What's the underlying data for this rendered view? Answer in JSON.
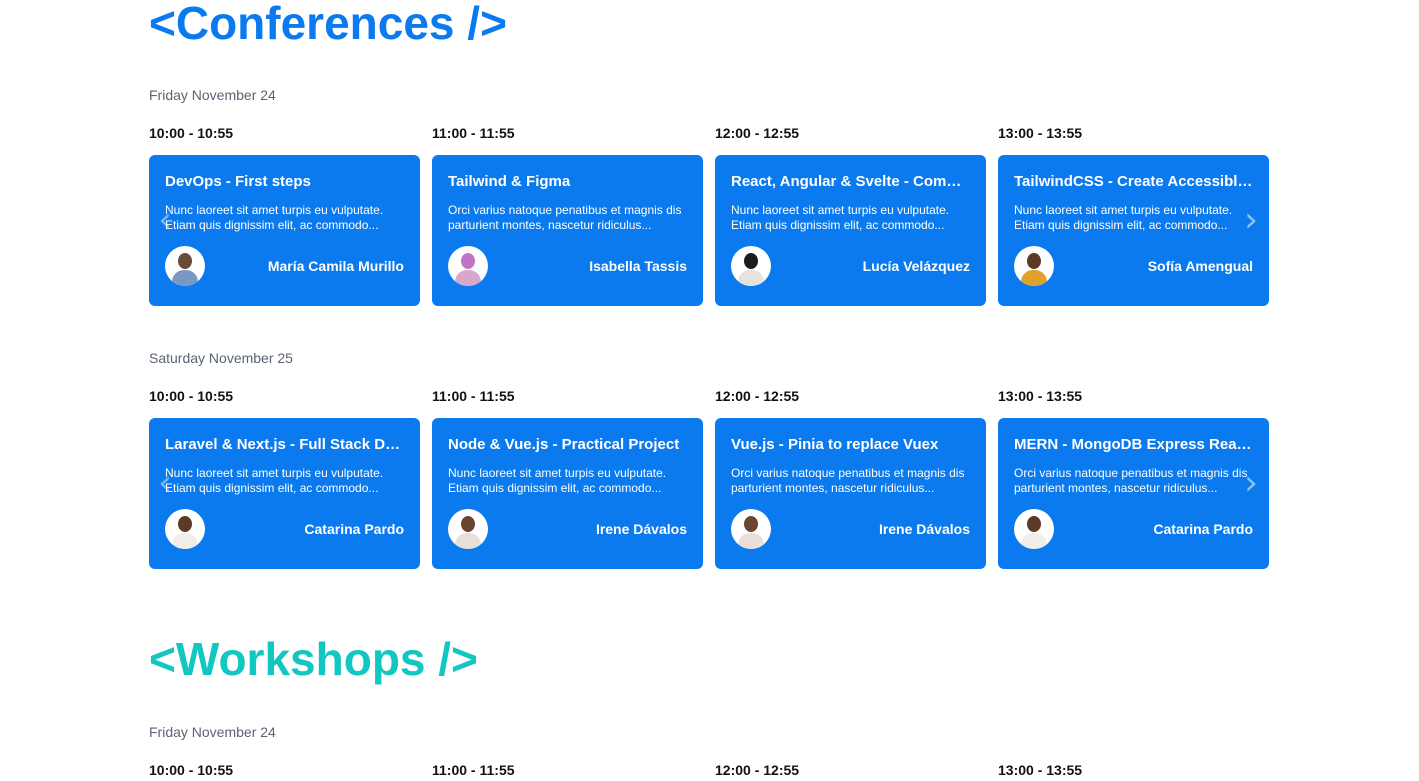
{
  "conferences": {
    "title": "<Conferences />",
    "days": [
      {
        "label": "Friday November 24",
        "times": [
          "10:00 - 10:55",
          "11:00 - 11:55",
          "12:00 - 12:55",
          "13:00 - 13:55"
        ],
        "cards": [
          {
            "title": "DevOps - First steps",
            "desc": "Nunc laoreet sit amet turpis eu vulputate. Etiam quis dignissim elit, ac commodo...",
            "speaker": "María Camila Murillo",
            "avatar_colors": [
              "#6b4a3a",
              "#7a98c6"
            ]
          },
          {
            "title": "Tailwind & Figma",
            "desc": "Orci varius natoque penatibus et magnis dis parturient montes, nascetur ridiculus...",
            "speaker": "Isabella Tassis",
            "avatar_colors": [
              "#c274c4",
              "#d8a7c9"
            ]
          },
          {
            "title": "React, Angular & Svelte - Comparison",
            "desc": "Nunc laoreet sit amet turpis eu vulputate. Etiam quis dignissim elit, ac commodo...",
            "speaker": "Lucía Velázquez",
            "avatar_colors": [
              "#1f1a17",
              "#e6e2dc"
            ]
          },
          {
            "title": "TailwindCSS - Create Accessible Components",
            "desc": "Nunc laoreet sit amet turpis eu vulputate. Etiam quis dignissim elit, ac commodo...",
            "speaker": "Sofía Amengual",
            "avatar_colors": [
              "#5a3a22",
              "#e1a12a"
            ]
          }
        ]
      },
      {
        "label": "Saturday November 25",
        "times": [
          "10:00 - 10:55",
          "11:00 - 11:55",
          "12:00 - 12:55",
          "13:00 - 13:55"
        ],
        "cards": [
          {
            "title": "Laravel & Next.js - Full Stack Development",
            "desc": "Nunc laoreet sit amet turpis eu vulputate. Etiam quis dignissim elit, ac commodo...",
            "speaker": "Catarina Pardo",
            "avatar_colors": [
              "#5b3a28",
              "#f1ede8"
            ]
          },
          {
            "title": "Node & Vue.js - Practical Project",
            "desc": "Nunc laoreet sit amet turpis eu vulputate. Etiam quis dignissim elit, ac commodo...",
            "speaker": "Irene Dávalos",
            "avatar_colors": [
              "#6a4632",
              "#e8e0d8"
            ]
          },
          {
            "title": "Vue.js - Pinia to replace Vuex",
            "desc": "Orci varius natoque penatibus et magnis dis parturient montes, nascetur ridiculus...",
            "speaker": "Irene Dávalos",
            "avatar_colors": [
              "#6a4632",
              "#e8e0d8"
            ]
          },
          {
            "title": "MERN - MongoDB Express React Node",
            "desc": "Orci varius natoque penatibus et magnis dis parturient montes, nascetur ridiculus...",
            "speaker": "Catarina Pardo",
            "avatar_colors": [
              "#5b3a28",
              "#f1ede8"
            ]
          }
        ]
      }
    ]
  },
  "workshops": {
    "title": "<Workshops />",
    "days": [
      {
        "label": "Friday November 24",
        "times": [
          "10:00 - 10:55",
          "11:00 - 11:55",
          "12:00 - 12:55",
          "13:00 - 13:55"
        ]
      }
    ]
  },
  "carousel": {
    "prev_glyph": "‹",
    "next_glyph": "›"
  },
  "colors": {
    "conference_accent": "#0a7aee",
    "workshop_accent": "#12c6c1"
  }
}
